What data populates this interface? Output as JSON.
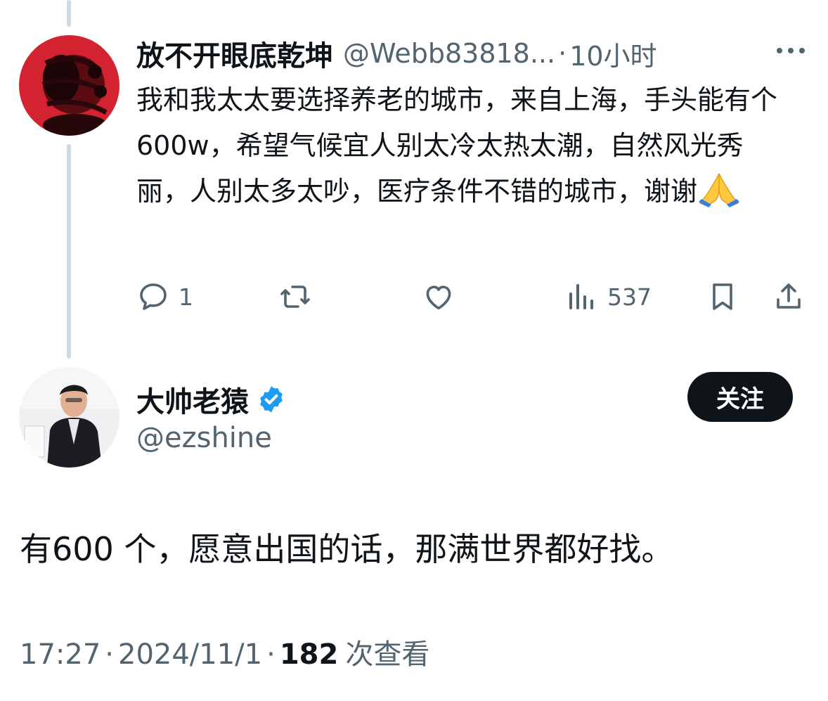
{
  "reply": {
    "display_name": "放不开眼底乾坤",
    "handle": "@Webb83818...",
    "separator": "·",
    "time": "10小时",
    "text": "我和我太太要选择养老的城市，来自上海，手头能有个600w，希望气候宜人别太冷太热太潮，自然风光秀丽，人别太多太吵，医疗条件不错的城市，谢谢",
    "actions": {
      "reply_count": "1",
      "retweet_count": "",
      "like_count": "",
      "views_count": "537"
    }
  },
  "author": {
    "display_name": "大帅老猿",
    "handle": "@ezshine",
    "follow_label": "关注"
  },
  "main_post": {
    "text": "有600 个，愿意出国的话，那满世界都好找。",
    "time": "17:27",
    "separator": "·",
    "date": "2024/11/1",
    "views_count": "182",
    "views_label": "次查看"
  },
  "colors": {
    "text_primary": "#0f1419",
    "text_secondary": "#536471",
    "thread_line": "#cfd9de",
    "verified_blue": "#1d9bf0",
    "follow_bg": "#0f1419"
  },
  "icons": [
    "more-icon",
    "reply-icon",
    "retweet-icon",
    "like-icon",
    "views-icon",
    "bookmark-icon",
    "share-icon",
    "verified-icon",
    "pray-emoji"
  ]
}
